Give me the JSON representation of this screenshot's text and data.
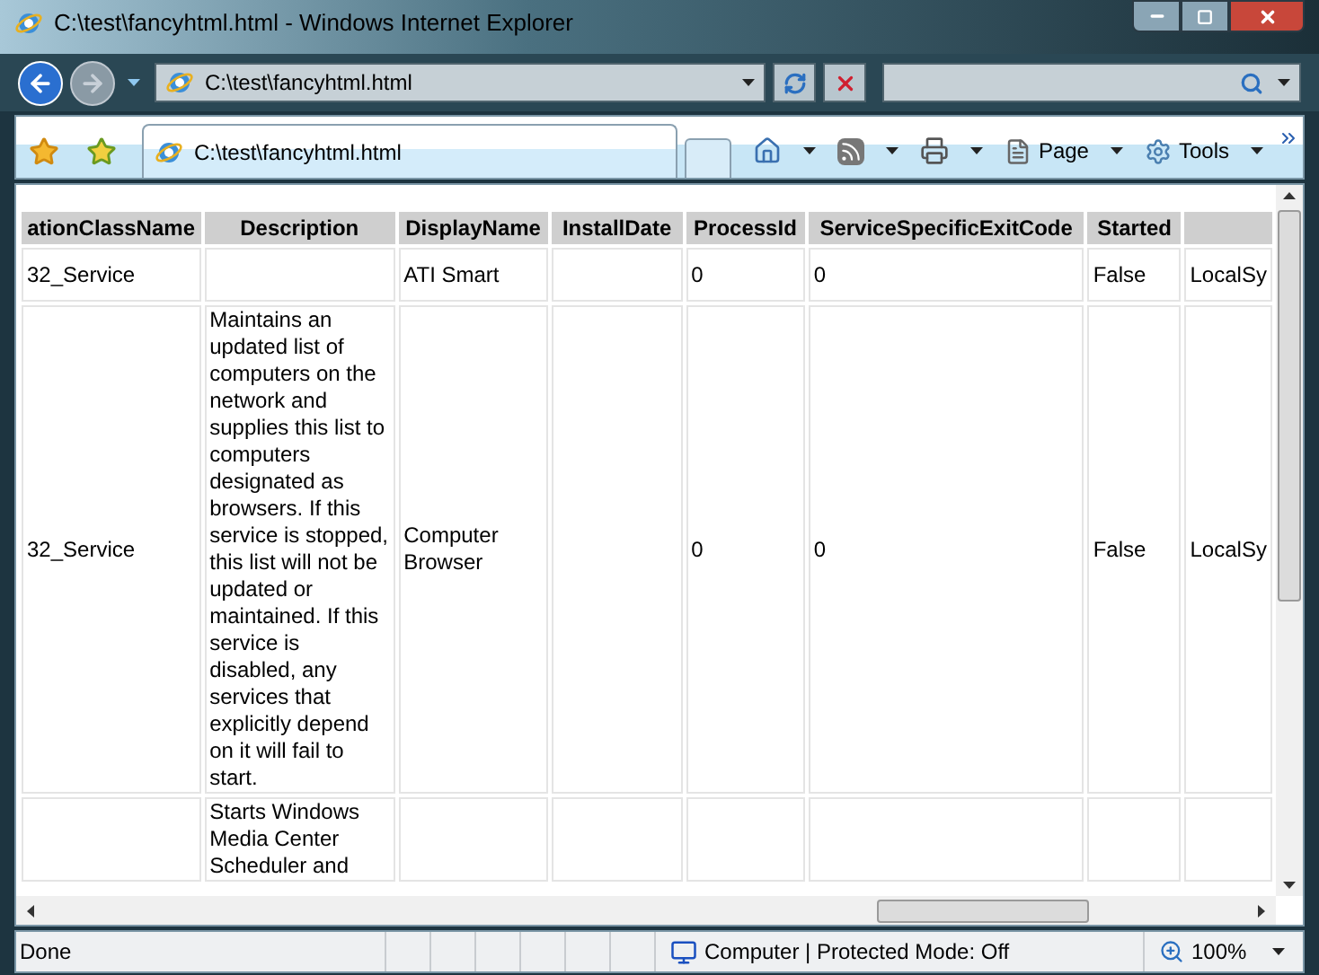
{
  "window": {
    "title": "C:\\test\\fancyhtml.html - Windows Internet Explorer"
  },
  "address_bar": {
    "value": "C:\\test\\fancyhtml.html"
  },
  "tabs": [
    {
      "label": "C:\\test\\fancyhtml.html",
      "selected": true
    }
  ],
  "command_bar": [
    {
      "kind": "home"
    },
    {
      "kind": "feeds"
    },
    {
      "kind": "print"
    },
    {
      "kind": "page",
      "label": "Page"
    },
    {
      "kind": "tools",
      "label": "Tools"
    }
  ],
  "table": {
    "columns": [
      {
        "label": "ationClassName"
      },
      {
        "label": "Description"
      },
      {
        "label": "DisplayName"
      },
      {
        "label": "InstallDate"
      },
      {
        "label": "ProcessId"
      },
      {
        "label": "ServiceSpecificExitCode"
      },
      {
        "label": "Started"
      },
      {}
    ],
    "rows": [
      {
        "cells": [
          {
            "text": "32_Service"
          },
          {},
          {
            "text": "ATI Smart"
          },
          {},
          {
            "text": "0"
          },
          {
            "text": "0"
          },
          {
            "text": "False"
          },
          {
            "text": "LocalSy"
          }
        ]
      },
      {
        "cells": [
          {
            "text": "32_Service"
          },
          {
            "text": "Maintains an updated list of computers on the network and supplies this list to computers designated as browsers. If this service is stopped, this list will not be updated or maintained. If this service is disabled, any services that explicitly depend on it will fail to start."
          },
          {
            "text": "Computer Browser"
          },
          {},
          {
            "text": "0"
          },
          {
            "text": "0"
          },
          {
            "text": "False"
          },
          {
            "text": "LocalSy"
          }
        ]
      },
      {
        "cells": [
          {},
          {
            "text": "Starts Windows Media Center Scheduler and"
          },
          {},
          {},
          {},
          {},
          {},
          {}
        ]
      }
    ]
  },
  "status_bar": {
    "text": "Done",
    "zone": "Computer | Protected Mode: Off",
    "zoom": "100%"
  }
}
